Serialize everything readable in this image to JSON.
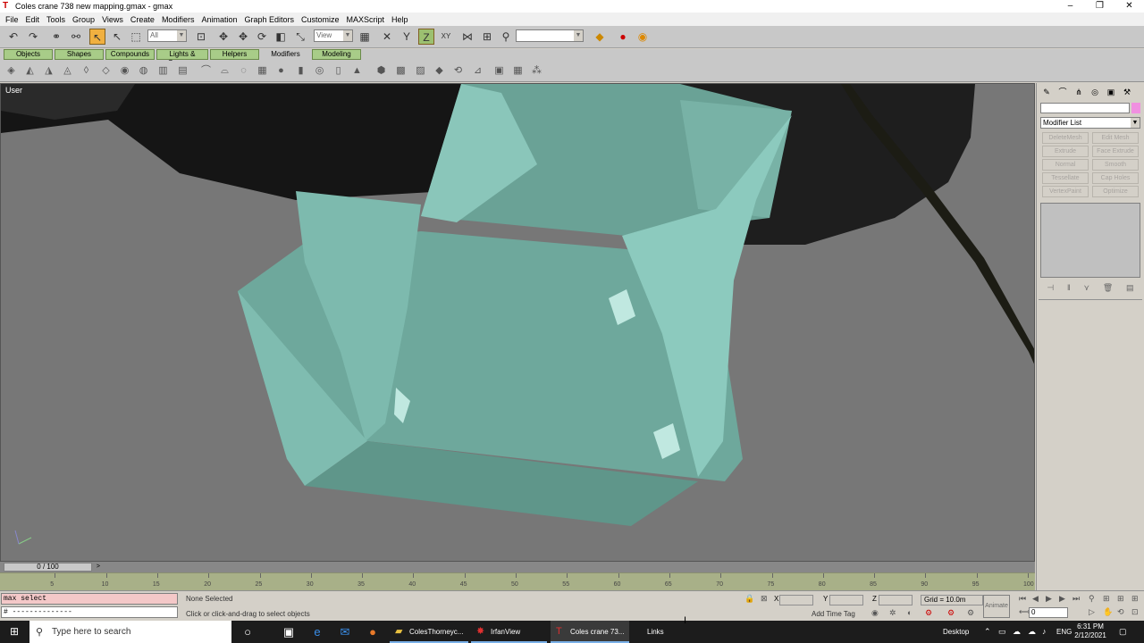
{
  "window": {
    "title": "Coles crane 738 new mapping.gmax - gmax",
    "minimize": "–",
    "maximize": "❐",
    "close": "✕"
  },
  "menu": [
    "File",
    "Edit",
    "Tools",
    "Group",
    "Views",
    "Create",
    "Modifiers",
    "Animation",
    "Graph Editors",
    "Customize",
    "MAXScript",
    "Help"
  ],
  "toolbar": {
    "selection_filter": "All",
    "ref_coord": "View",
    "named_selection": ""
  },
  "tabs": [
    {
      "label": "Objects",
      "active": false
    },
    {
      "label": "Shapes",
      "active": false
    },
    {
      "label": "Compounds",
      "active": false
    },
    {
      "label": "Lights & Cameras",
      "active": false
    },
    {
      "label": "Helpers",
      "active": false
    },
    {
      "label": "Modifiers",
      "active": true
    },
    {
      "label": "Modeling",
      "active": false
    }
  ],
  "viewport": {
    "label": "User"
  },
  "command_panel": {
    "modifier_list": "Modifier List",
    "modifier_buttons": [
      "DeleteMesh",
      "Edit Mesh",
      "Extrude",
      "Face Extrude",
      "Normal",
      "Smooth",
      "Tessellate",
      "Cap Holes",
      "VertexPaint",
      "Optimize"
    ]
  },
  "timeline": {
    "slider": "0 / 100",
    "ticks": [
      5,
      10,
      15,
      20,
      25,
      30,
      35,
      40,
      45,
      50,
      55,
      60,
      65,
      70,
      75,
      80,
      85,
      90,
      95,
      100
    ]
  },
  "status": {
    "maxscript_listener": "max select",
    "maxscript_line": "#  --------------",
    "selection": "None Selected",
    "prompt": "Click or click-and-drag to select objects",
    "x_label": "X",
    "y_label": "Y",
    "z_label": "Z",
    "grid": "Grid = 10.0m",
    "add_time_tag": "Add Time Tag",
    "animate": "Animate",
    "current_frame": "0"
  },
  "taskbar": {
    "search_placeholder": "Type here to search",
    "tasks": [
      {
        "label": "ColesThorneyc...",
        "state": "open"
      },
      {
        "label": "IrfanView",
        "state": "open"
      },
      {
        "label": "Coles crane 73...",
        "state": "active"
      }
    ],
    "links": "Links",
    "desktop": "Desktop",
    "lang": "ENG",
    "time": "6:31 PM",
    "date": "2/12/2021"
  },
  "colors": {
    "model_teal": "#7fbcb0",
    "viewport_bg": "#777777",
    "tab_green": "#a8cc88",
    "taskbar": "#1c1c1c"
  }
}
